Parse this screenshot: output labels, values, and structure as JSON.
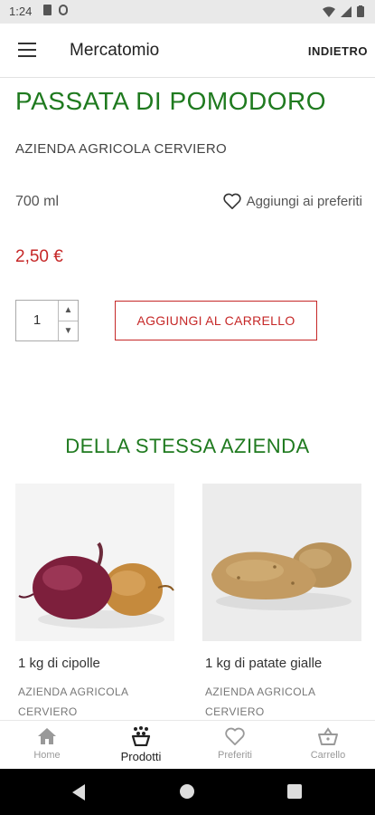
{
  "statusbar": {
    "time": "1:24"
  },
  "appbar": {
    "title": "Mercatomio",
    "back_label": "INDIETRO"
  },
  "product": {
    "title": "PASSATA DI POMODORO",
    "producer": "AZIENDA AGRICOLA CERVIERO",
    "size": "700 ml",
    "favorite_label": "Aggiungi ai preferiti",
    "price": "2,50 €",
    "quantity": "1",
    "add_to_cart_label": "AGGIUNGI AL CARRELLO"
  },
  "related": {
    "title": "DELLA STESSA AZIENDA",
    "items": [
      {
        "name": "1 kg di cipolle",
        "producer": "AZIENDA AGRICOLA CERVIERO"
      },
      {
        "name": "1 kg di patate gialle",
        "producer": "AZIENDA AGRICOLA CERVIERO"
      }
    ]
  },
  "bottom_nav": [
    {
      "label": "Home",
      "icon": "home-icon"
    },
    {
      "label": "Prodotti",
      "icon": "products-basket-icon",
      "active": true
    },
    {
      "label": "Preferiti",
      "icon": "heart-icon"
    },
    {
      "label": "Carrello",
      "icon": "cart-basket-icon"
    }
  ],
  "colors": {
    "accent_green": "#1f7a1f",
    "price_red": "#c62828"
  }
}
